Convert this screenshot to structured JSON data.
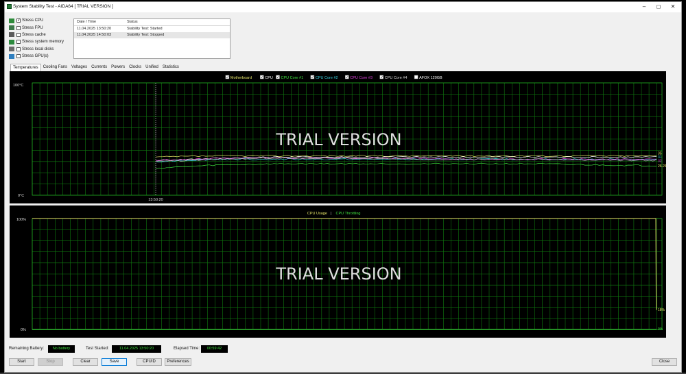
{
  "window": {
    "title": "System Stability Test - AIDA64  [ TRIAL VERSION ]",
    "controls": [
      "–",
      "◻",
      "✕"
    ]
  },
  "stress": [
    {
      "label": "Stress CPU",
      "checked": true,
      "icon": "cpu-chip-icon",
      "color": "#2e8b3a"
    },
    {
      "label": "Stress FPU",
      "checked": false,
      "icon": "fpu-chip-icon",
      "color": "#3d7a4a"
    },
    {
      "label": "Stress cache",
      "checked": false,
      "icon": "cache-chip-icon",
      "color": "#5a5a5a"
    },
    {
      "label": "Stress system memory",
      "checked": false,
      "icon": "memory-module-icon",
      "color": "#2c8a3e"
    },
    {
      "label": "Stress local disks",
      "checked": false,
      "icon": "disk-drive-icon",
      "color": "#6b6b6b"
    },
    {
      "label": "Stress GPU(s)",
      "checked": false,
      "icon": "gpu-card-icon",
      "color": "#2f7fbf"
    }
  ],
  "log": {
    "headers": [
      "Date / Time",
      "Status"
    ],
    "rows": [
      [
        "11.04.2025 13:50:20",
        "Stability Test: Started"
      ],
      [
        "11.04.2025 14:50:03",
        "Stability Test: Stopped"
      ]
    ]
  },
  "tabs": [
    "Temperatures",
    "Cooling Fans",
    "Voltages",
    "Currents",
    "Powers",
    "Clocks",
    "Unified",
    "Statistics"
  ],
  "temp_chart": {
    "legend": [
      {
        "label": "Motherboard",
        "color": "#e8e86a"
      },
      {
        "label": "CPU",
        "color": "#ffffff"
      },
      {
        "label": "CPU Core #1",
        "color": "#3fe23f"
      },
      {
        "label": "CPU Core #2",
        "color": "#3ad6e6"
      },
      {
        "label": "CPU Core #3",
        "color": "#e040e0"
      },
      {
        "label": "CPU Core #4",
        "color": "#dedede"
      },
      {
        "label": "AFOX 120GB",
        "color": "#ffffff"
      }
    ],
    "legend_checked": [
      true,
      true,
      true,
      true,
      true,
      true,
      false
    ],
    "y_top": "100°C",
    "y_bottom": "0°C",
    "x_label": "13:50:20",
    "watermark": "TRIAL VERSION",
    "end_labels": [
      "35",
      "31",
      "32",
      "26.26"
    ]
  },
  "usage_chart": {
    "legend": [
      {
        "label": "CPU Usage",
        "color": "#e8e86a"
      },
      {
        "label": "CPU Throttling",
        "color": "#3fe23f"
      }
    ],
    "separator": "|",
    "y_top": "100%",
    "y_bottom": "0%",
    "watermark": "TRIAL VERSION",
    "end_labels": [
      "18%",
      "0%"
    ]
  },
  "chart_data": [
    {
      "type": "line",
      "title": "",
      "ylim": [
        0,
        100
      ],
      "y_unit": "°C",
      "x_start": "13:50:20",
      "series": [
        {
          "name": "Motherboard",
          "values": [
            34,
            35,
            35,
            35,
            35,
            35,
            35,
            35,
            35
          ]
        },
        {
          "name": "CPU",
          "values": [
            31,
            33,
            34,
            34,
            34,
            34,
            34,
            34,
            34
          ]
        },
        {
          "name": "CPU Core #1",
          "values": [
            24,
            27,
            28,
            28,
            28,
            28,
            28,
            27,
            26.26
          ]
        },
        {
          "name": "CPU Core #2",
          "values": [
            30,
            32,
            32,
            32,
            32,
            32,
            32,
            32,
            32
          ]
        },
        {
          "name": "CPU Core #3",
          "values": [
            31,
            33,
            33,
            33,
            33,
            32,
            32,
            32,
            32
          ]
        },
        {
          "name": "CPU Core #4",
          "values": [
            30,
            32,
            33,
            33,
            32,
            32,
            32,
            31,
            31
          ]
        }
      ],
      "grid": true
    },
    {
      "type": "line",
      "title": "",
      "ylim": [
        0,
        100
      ],
      "y_unit": "%",
      "series": [
        {
          "name": "CPU Usage",
          "values": [
            100,
            100,
            100,
            100,
            100,
            100,
            100,
            100,
            18
          ]
        },
        {
          "name": "CPU Throttling",
          "values": [
            0,
            0,
            0,
            0,
            0,
            0,
            0,
            0,
            0
          ]
        }
      ],
      "grid": true
    }
  ],
  "status": {
    "battery_label": "Remaining Battery:",
    "battery_value": "No battery",
    "started_label": "Test Started:",
    "started_value": "11.04.2025 13:50:20",
    "elapsed_label": "Elapsed Time:",
    "elapsed_value": "00:59:42"
  },
  "buttons": {
    "start": "Start",
    "stop": "Stop",
    "clear": "Clear",
    "save": "Save",
    "cpuid": "CPUID",
    "preferences": "Preferences",
    "close": "Close"
  },
  "colors": {
    "grid": "#0f7a0f",
    "grid_bright": "#21a821",
    "chart_bg": "#000000",
    "watermark": "#dedede"
  }
}
